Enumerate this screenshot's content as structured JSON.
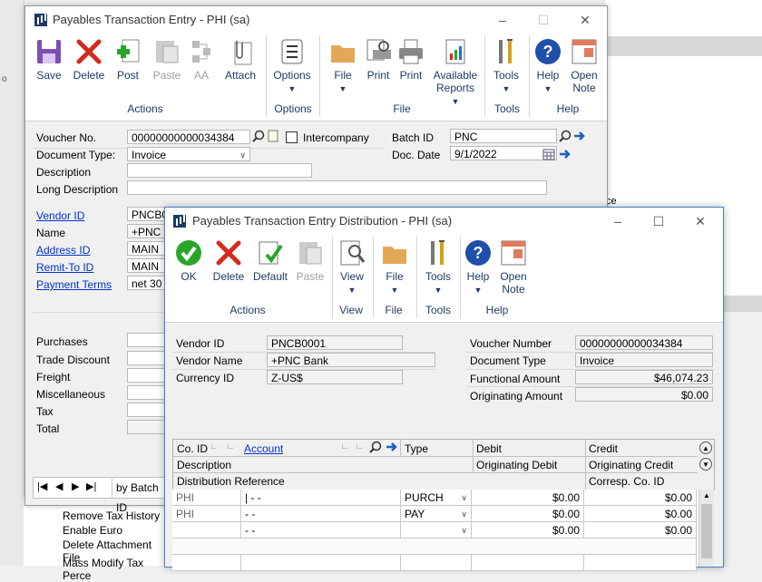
{
  "background": {
    "bottom_items": [
      "Remove Tax History",
      "Enable Euro",
      "Delete Attachment File",
      "Mass Modify Tax Perce"
    ],
    "right_fragment": "ce"
  },
  "main_window": {
    "title": "Payables Transaction Entry  -  PHI (sa)",
    "ribbon": {
      "buttons": {
        "save": "Save",
        "delete": "Delete",
        "post": "Post",
        "paste": "Paste",
        "aa": "AA",
        "attach": "Attach",
        "options": "Options",
        "file": "File",
        "print1": "Print",
        "print2": "Print",
        "available_reports": "Available Reports",
        "tools": "Tools",
        "help": "Help",
        "open_note": "Open Note"
      },
      "groups": {
        "actions": "Actions",
        "options": "Options",
        "file": "File",
        "tools": "Tools",
        "help": "Help"
      }
    },
    "form": {
      "voucher_no_label": "Voucher No.",
      "voucher_no": "00000000000034384",
      "intercompany_label": "Intercompany",
      "batch_id_label": "Batch ID",
      "batch_id": "PNC",
      "document_type_label": "Document Type:",
      "document_type": "Invoice",
      "doc_date_label": "Doc. Date",
      "doc_date": "9/1/2022",
      "description_label": "Description",
      "description": "",
      "long_description_label": "Long Description",
      "long_description": "",
      "vendor_id_label": "Vendor ID",
      "vendor_id": "PNCB0",
      "name_label": "Name",
      "name": "+PNC B",
      "address_id_label": "Address ID",
      "address_id": "MAIN",
      "remit_to_id_label": "Remit-To ID",
      "remit_to_id": "MAIN",
      "payment_terms_label": "Payment Terms",
      "payment_terms": "net 30",
      "totals_labels": [
        "Purchases",
        "Trade Discount",
        "Freight",
        "Miscellaneous",
        "Tax",
        "Total"
      ],
      "browse_by": "by Batch ID"
    }
  },
  "dist_window": {
    "title": "Payables Transaction Entry Distribution  -  PHI (sa)",
    "ribbon": {
      "buttons": {
        "ok": "OK",
        "delete": "Delete",
        "default": "Default",
        "paste": "Paste",
        "view": "View",
        "file": "File",
        "tools": "Tools",
        "help": "Help",
        "open_note": "Open Note"
      },
      "groups": {
        "actions": "Actions",
        "view": "View",
        "file": "File",
        "tools": "Tools",
        "help": "Help"
      }
    },
    "header": {
      "vendor_id_label": "Vendor ID",
      "vendor_id": "PNCB0001",
      "vendor_name_label": "Vendor Name",
      "vendor_name": "+PNC Bank",
      "currency_id_label": "Currency ID",
      "currency_id": "Z-US$",
      "voucher_number_label": "Voucher Number",
      "voucher_number": "00000000000034384",
      "document_type_label": "Document Type",
      "document_type": "Invoice",
      "functional_amount_label": "Functional Amount",
      "functional_amount": "$46,074.23",
      "originating_amount_label": "Originating Amount",
      "originating_amount": "$0.00"
    },
    "grid": {
      "col_co_id": "Co. ID",
      "col_account": "Account",
      "col_type": "Type",
      "col_debit": "Debit",
      "col_credit": "Credit",
      "col_description": "Description",
      "col_orig_debit": "Originating Debit",
      "col_orig_credit": "Originating Credit",
      "col_dist_ref": "Distribution Reference",
      "col_corresp": "Corresp. Co. ID",
      "rows": [
        {
          "co": "PHI",
          "account": "|      -    -",
          "type": "PURCH",
          "debit": "$0.00",
          "credit": "$0.00"
        },
        {
          "co": "PHI",
          "account": "      -    -",
          "type": "PAY",
          "debit": "$0.00",
          "credit": "$0.00"
        },
        {
          "co": "",
          "account": "      -    -",
          "type": "",
          "debit": "$0.00",
          "credit": "$0.00"
        }
      ]
    }
  }
}
